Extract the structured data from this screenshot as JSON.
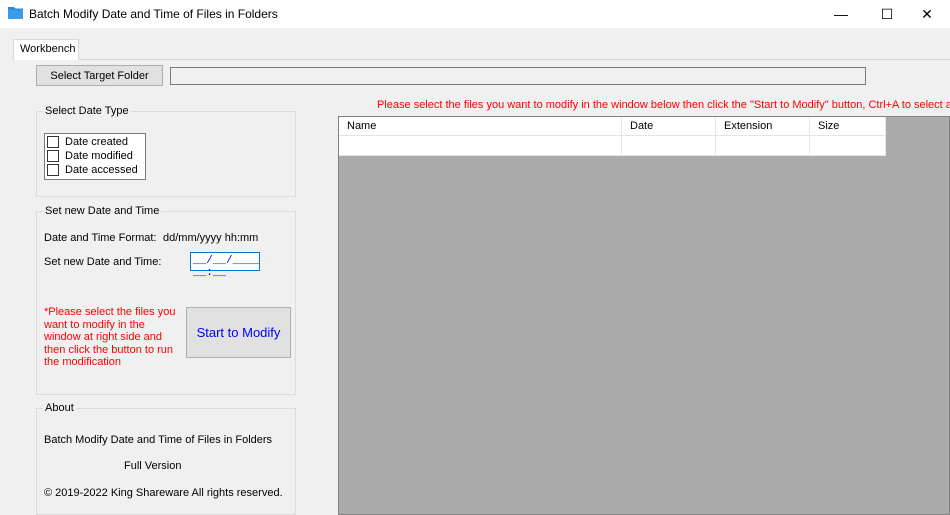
{
  "window": {
    "title": "Batch Modify Date and Time of Files in Folders",
    "minimize_glyph": "—",
    "maximize_glyph": "☐",
    "close_glyph": "✕"
  },
  "tabs": [
    {
      "label": "Workbench",
      "selected": true
    }
  ],
  "toolbar": {
    "select_folder_label": "Select Target Folder",
    "folder_path_value": ""
  },
  "date_type": {
    "title": "Select Date Type",
    "options": [
      {
        "label": "Date created",
        "checked": false
      },
      {
        "label": "Date modified",
        "checked": false
      },
      {
        "label": "Date accessed",
        "checked": false
      }
    ]
  },
  "set_date": {
    "title": "Set new Date and Time",
    "format_label": "Date and Time Format:",
    "format_value": "dd/mm/yyyy hh:mm",
    "input_label": "Set new Date and Time:",
    "input_value": "__/__/____ __:__",
    "warning": "*Please select the files you want to modify in the window at right side and then click the button to run the modification",
    "start_label": "Start to Modify"
  },
  "about": {
    "title": "About",
    "product": "Batch Modify Date and Time of Files in Folders",
    "edition": "Full Version",
    "copyright": "© 2019-2022 King Shareware All rights reserved."
  },
  "file_list": {
    "hint": "Please select the files you want to modify in the window below then click the \"Start to Modify\" button, Ctrl+A to select all files",
    "columns": [
      "Name",
      "Date",
      "Extension",
      "Size"
    ],
    "rows": []
  },
  "colors": {
    "warning_text": "#ff0000",
    "start_button_text": "#0000ff",
    "list_background": "#ababab",
    "app_icon": "#2b87d8"
  }
}
